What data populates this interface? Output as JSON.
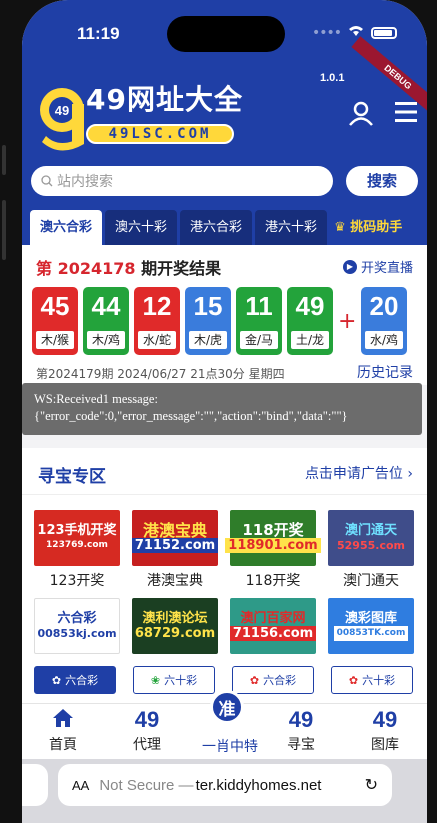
{
  "status": {
    "time": "11:19"
  },
  "header": {
    "brand_digits": "49",
    "title": "49网址大全",
    "domain": "49LSC.COM",
    "version": "1.0.1",
    "debug_banner": "DEBUG"
  },
  "search": {
    "placeholder": "站内搜索",
    "button": "搜索"
  },
  "tabs": [
    {
      "label": "澳六合彩",
      "active": true
    },
    {
      "label": "澳六十彩"
    },
    {
      "label": "港六合彩"
    },
    {
      "label": "港六十彩"
    },
    {
      "label": "挑码助手"
    }
  ],
  "results": {
    "prefix": "第",
    "issue": "2024178",
    "suffix": "期开奖结果",
    "live_label": "开奖直播",
    "balls": [
      {
        "num": "45",
        "zodiac": "木/猴",
        "color": "red"
      },
      {
        "num": "44",
        "zodiac": "木/鸡",
        "color": "green"
      },
      {
        "num": "12",
        "zodiac": "水/蛇",
        "color": "red"
      },
      {
        "num": "15",
        "zodiac": "木/虎",
        "color": "blue"
      },
      {
        "num": "11",
        "zodiac": "金/马",
        "color": "green"
      },
      {
        "num": "49",
        "zodiac": "土/龙",
        "color": "green"
      }
    ],
    "special": {
      "num": "20",
      "zodiac": "水/鸡",
      "color": "blue"
    },
    "plus": "+",
    "next_info": "第2024179期 2024/06/27 21点30分 星期四",
    "history": "历史记录"
  },
  "toast": {
    "line1": "WS:Received1 message:",
    "line2": "{\"error_code\":0,\"error_message\":\"\",\"action\":\"bind\",\"data\":\"\"}"
  },
  "treasure": {
    "title": "寻宝专区",
    "ad_link": "点击申请广告位 ›",
    "tiles": [
      {
        "lines": [
          "123手机开奖",
          "123769.com"
        ],
        "label": "123开奖",
        "bg": "#d62a22"
      },
      {
        "lines": [
          "港澳宝典",
          "71152.com"
        ],
        "label": "港澳宝典",
        "bg": "#c51f1f"
      },
      {
        "lines": [
          "118开奖",
          "118901.com"
        ],
        "label": "118开奖",
        "bg": "#2f7d2a"
      },
      {
        "lines": [
          "澳门通天",
          "52955.com"
        ],
        "label": "澳门通天",
        "bg": "#3f4d8a"
      },
      {
        "lines": [
          "六合彩",
          "00853kj.com"
        ],
        "label": "",
        "bg": "#ffffff"
      },
      {
        "lines": [
          "澳利澳论坛",
          "68729.com"
        ],
        "label": "",
        "bg": "#1b3f22"
      },
      {
        "lines": [
          "澳门百家网",
          "71156.com"
        ],
        "label": "",
        "bg": "#2e9a88"
      },
      {
        "lines": [
          "澳彩图库",
          "00853TK.com"
        ],
        "label": "",
        "bg": "#2f7de0"
      }
    ],
    "tags": [
      {
        "label": "六合彩",
        "active": true
      },
      {
        "label": "六十彩"
      },
      {
        "label": "六合彩"
      },
      {
        "label": "六十彩"
      }
    ]
  },
  "bottom_nav": {
    "home": "首頁",
    "agent_num": "49",
    "agent": "代理",
    "center_char": "准",
    "center_label": "一肖中特",
    "treasure_num": "49",
    "treasure": "寻宝",
    "gallery_num": "49",
    "gallery": "图库"
  },
  "browser": {
    "aa": "AA",
    "not_secure": "Not Secure —",
    "url": "ter.kiddyhomes.net"
  }
}
